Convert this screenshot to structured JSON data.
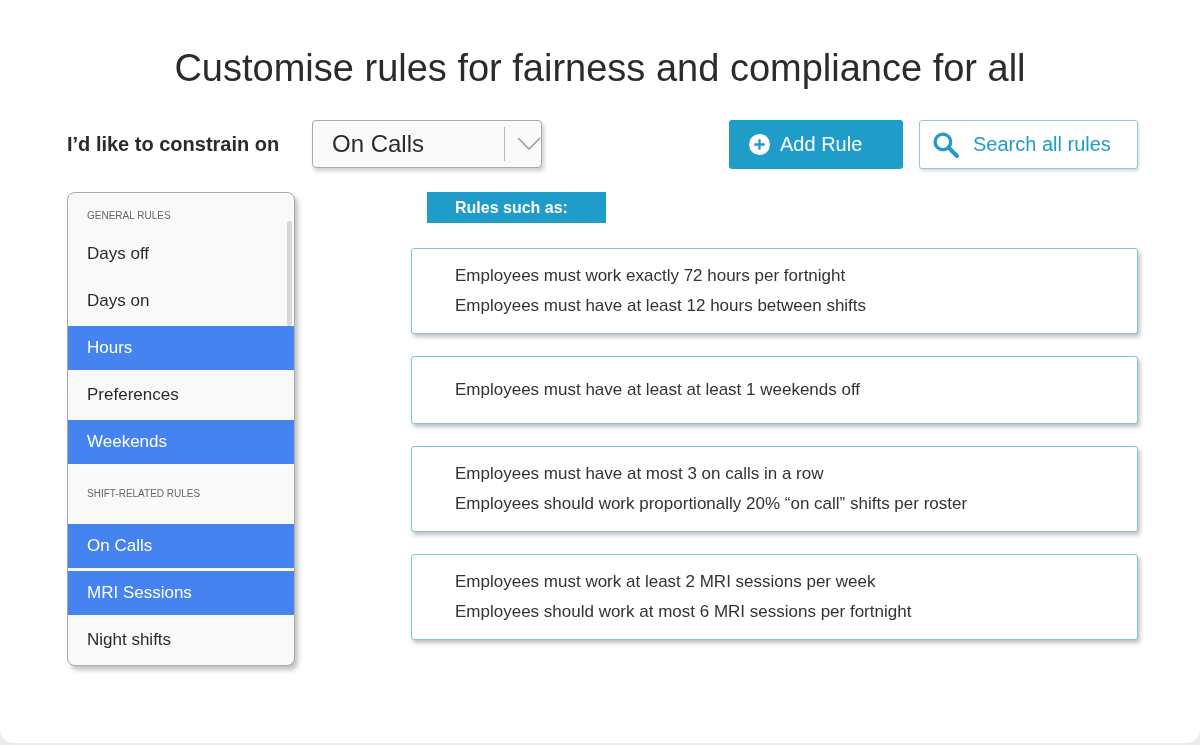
{
  "title": "Customise rules for fairness and compliance for all",
  "constraint": {
    "label": "I’d like to constrain on",
    "value": "On Calls"
  },
  "buttons": {
    "add": "Add Rule",
    "search": "Search all rules"
  },
  "rule_list": [
    {
      "heading": "GENERAL RULES",
      "items": [
        {
          "label": "Days off",
          "selected": false
        },
        {
          "label": "Days on",
          "selected": false
        },
        {
          "label": "Hours",
          "selected": true
        },
        {
          "label": "Preferences",
          "selected": false
        },
        {
          "label": "Weekends",
          "selected": true
        }
      ]
    },
    {
      "heading": "SHIFT-RELATED RULES",
      "items": [
        {
          "label": "On Calls",
          "selected": true
        },
        {
          "label": "MRI Sessions",
          "selected": true
        },
        {
          "label": "Night shifts",
          "selected": false
        }
      ]
    }
  ],
  "examples_heading": "Rules such as:",
  "example_cards": [
    {
      "lines": [
        "Employees must work exactly 72 hours per fortnight",
        "Employees must have at least 12 hours between shifts"
      ]
    },
    {
      "lines": [
        "Employees must have at least at least 1 weekends off"
      ]
    },
    {
      "lines": [
        "Employees must have at most 3 on calls in a row",
        "Employees should work proportionally 20% “on call” shifts per roster"
      ]
    },
    {
      "lines": [
        "Employees must work at least 2 MRI sessions per week",
        "Employees should work at most 6 MRI sessions per fortnight"
      ]
    }
  ]
}
